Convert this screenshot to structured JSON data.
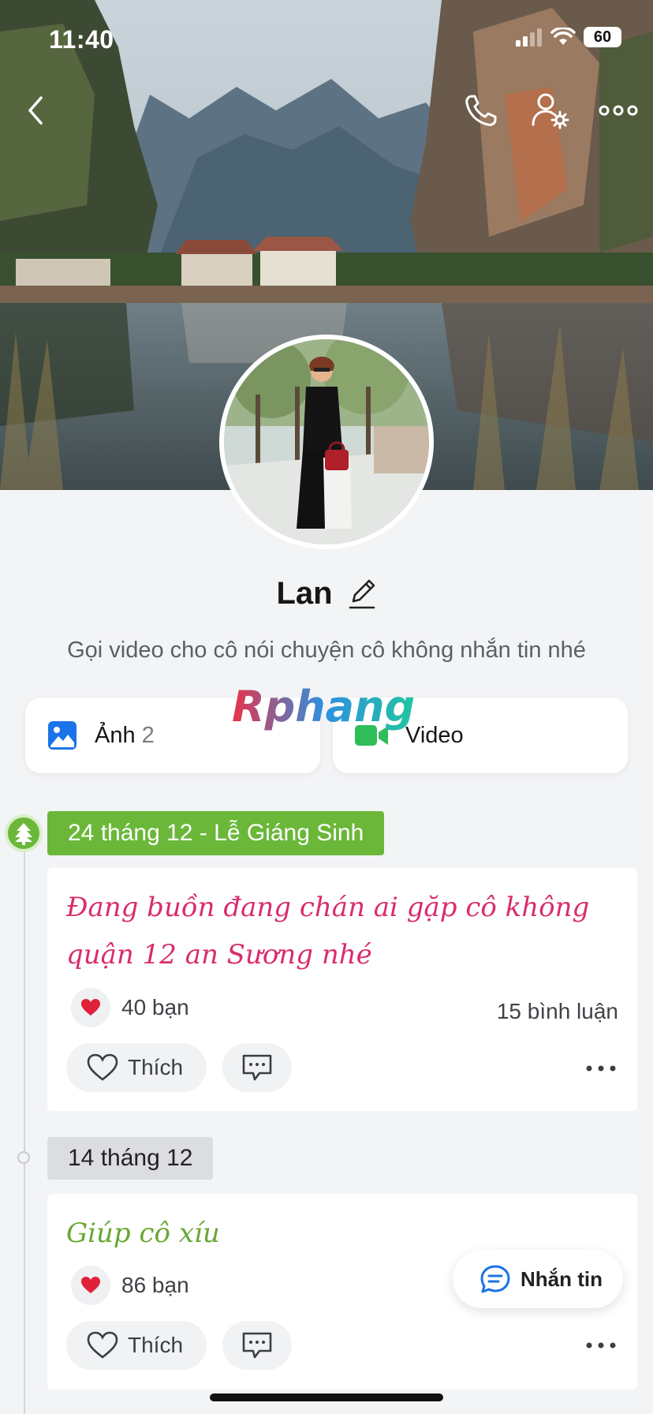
{
  "status_bar": {
    "time": "11:40",
    "battery": "60"
  },
  "profile": {
    "name": "Lan",
    "status": "Gọi video cho cô nói chuyện cô không nhắn tin nhé"
  },
  "media": {
    "photos_label": "Ảnh",
    "photos_count": "2",
    "video_label": "Video"
  },
  "watermark": "Rphang",
  "timeline": {
    "group1": {
      "date": "24 tháng 12 - Lễ Giáng Sinh",
      "post": {
        "text": "Đang buồn đang chán ai gặp cô không quận 12 an Sương nhé",
        "reactions": "40 bạn",
        "comments": "15 bình luận",
        "like_label": "Thích"
      }
    },
    "group2": {
      "date": "14 tháng 12",
      "post": {
        "text": "Giúp cô xíu",
        "reactions": "86 bạn",
        "like_label": "Thích"
      }
    }
  },
  "message_button": {
    "label": "Nhắn tin"
  },
  "colors": {
    "accent_green": "#6bb73a",
    "post_pink": "#d92c6e",
    "post_green": "#67a832",
    "link_blue": "#1a73e8",
    "video_green": "#2ebd59"
  },
  "icons": [
    "back-icon",
    "phone-icon",
    "friend-settings-icon",
    "more-icon",
    "edit-icon",
    "photo-icon",
    "video-camera-icon",
    "christmas-tree-icon",
    "heart-reaction-icon",
    "heart-outline-icon",
    "comment-icon",
    "message-icon"
  ]
}
